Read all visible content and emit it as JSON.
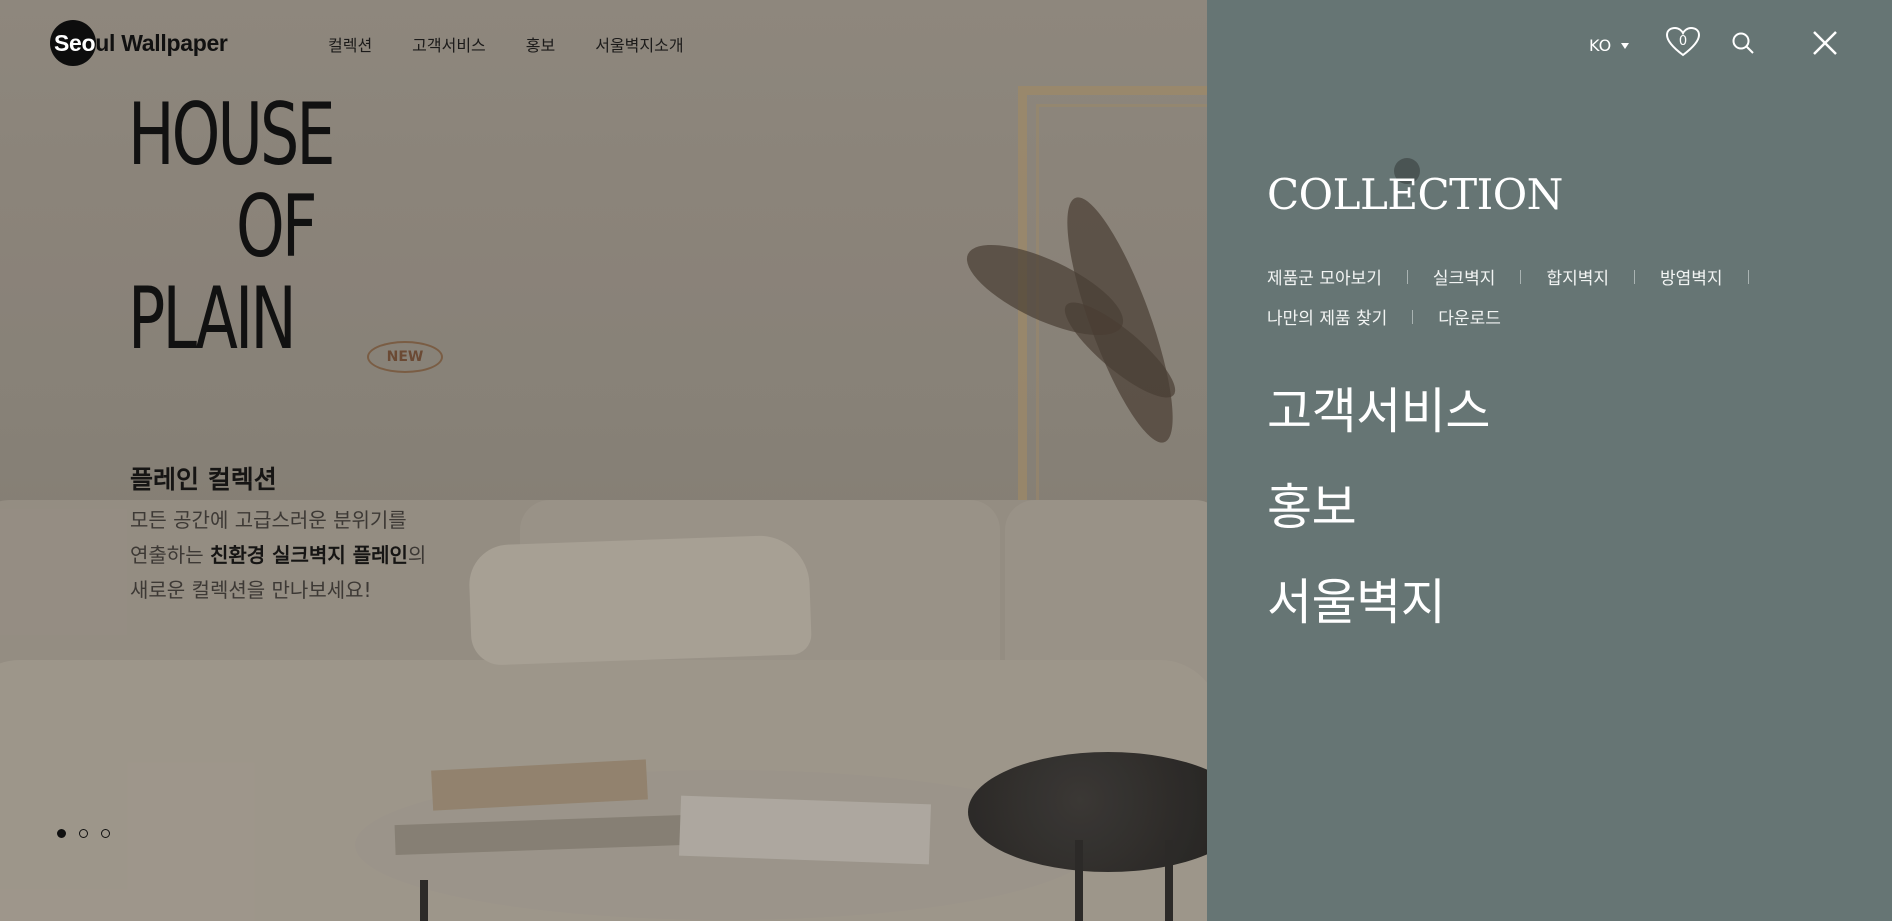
{
  "header": {
    "logo_prefix": "Seo",
    "logo_suffix": "ul Wallpaper",
    "nav": [
      "컬렉션",
      "고객서비스",
      "홍보",
      "서울벽지소개"
    ]
  },
  "hero": {
    "house_line1": "HOUSE",
    "house_line2": "OF",
    "house_line3": "PLAIN",
    "badge": "NEW",
    "title": "플레인 컬렉션",
    "desc_line1": "모든 공간에 고급스러운 분위기를",
    "desc_line2_pre": "연출하는 ",
    "desc_line2_bold": "친환경 실크벽지 플레인",
    "desc_line2_post": "의",
    "desc_line3": "새로운 컬렉션을 만나보세요!",
    "slides": 3,
    "active_slide": 1
  },
  "panel": {
    "lang": "KO",
    "wishlist_count": "0",
    "collection_title": "COLLECTION",
    "collection_links": [
      "제품군 모아보기",
      "실크벽지",
      "합지벽지",
      "방염벽지",
      "나만의 제품 찾기",
      "다운로드"
    ],
    "menu": [
      "고객서비스",
      "홍보",
      "서울벽지"
    ]
  },
  "colors": {
    "panel_bg": "#667574",
    "text_light": "#ffffff",
    "badge": "#7a5d44"
  }
}
